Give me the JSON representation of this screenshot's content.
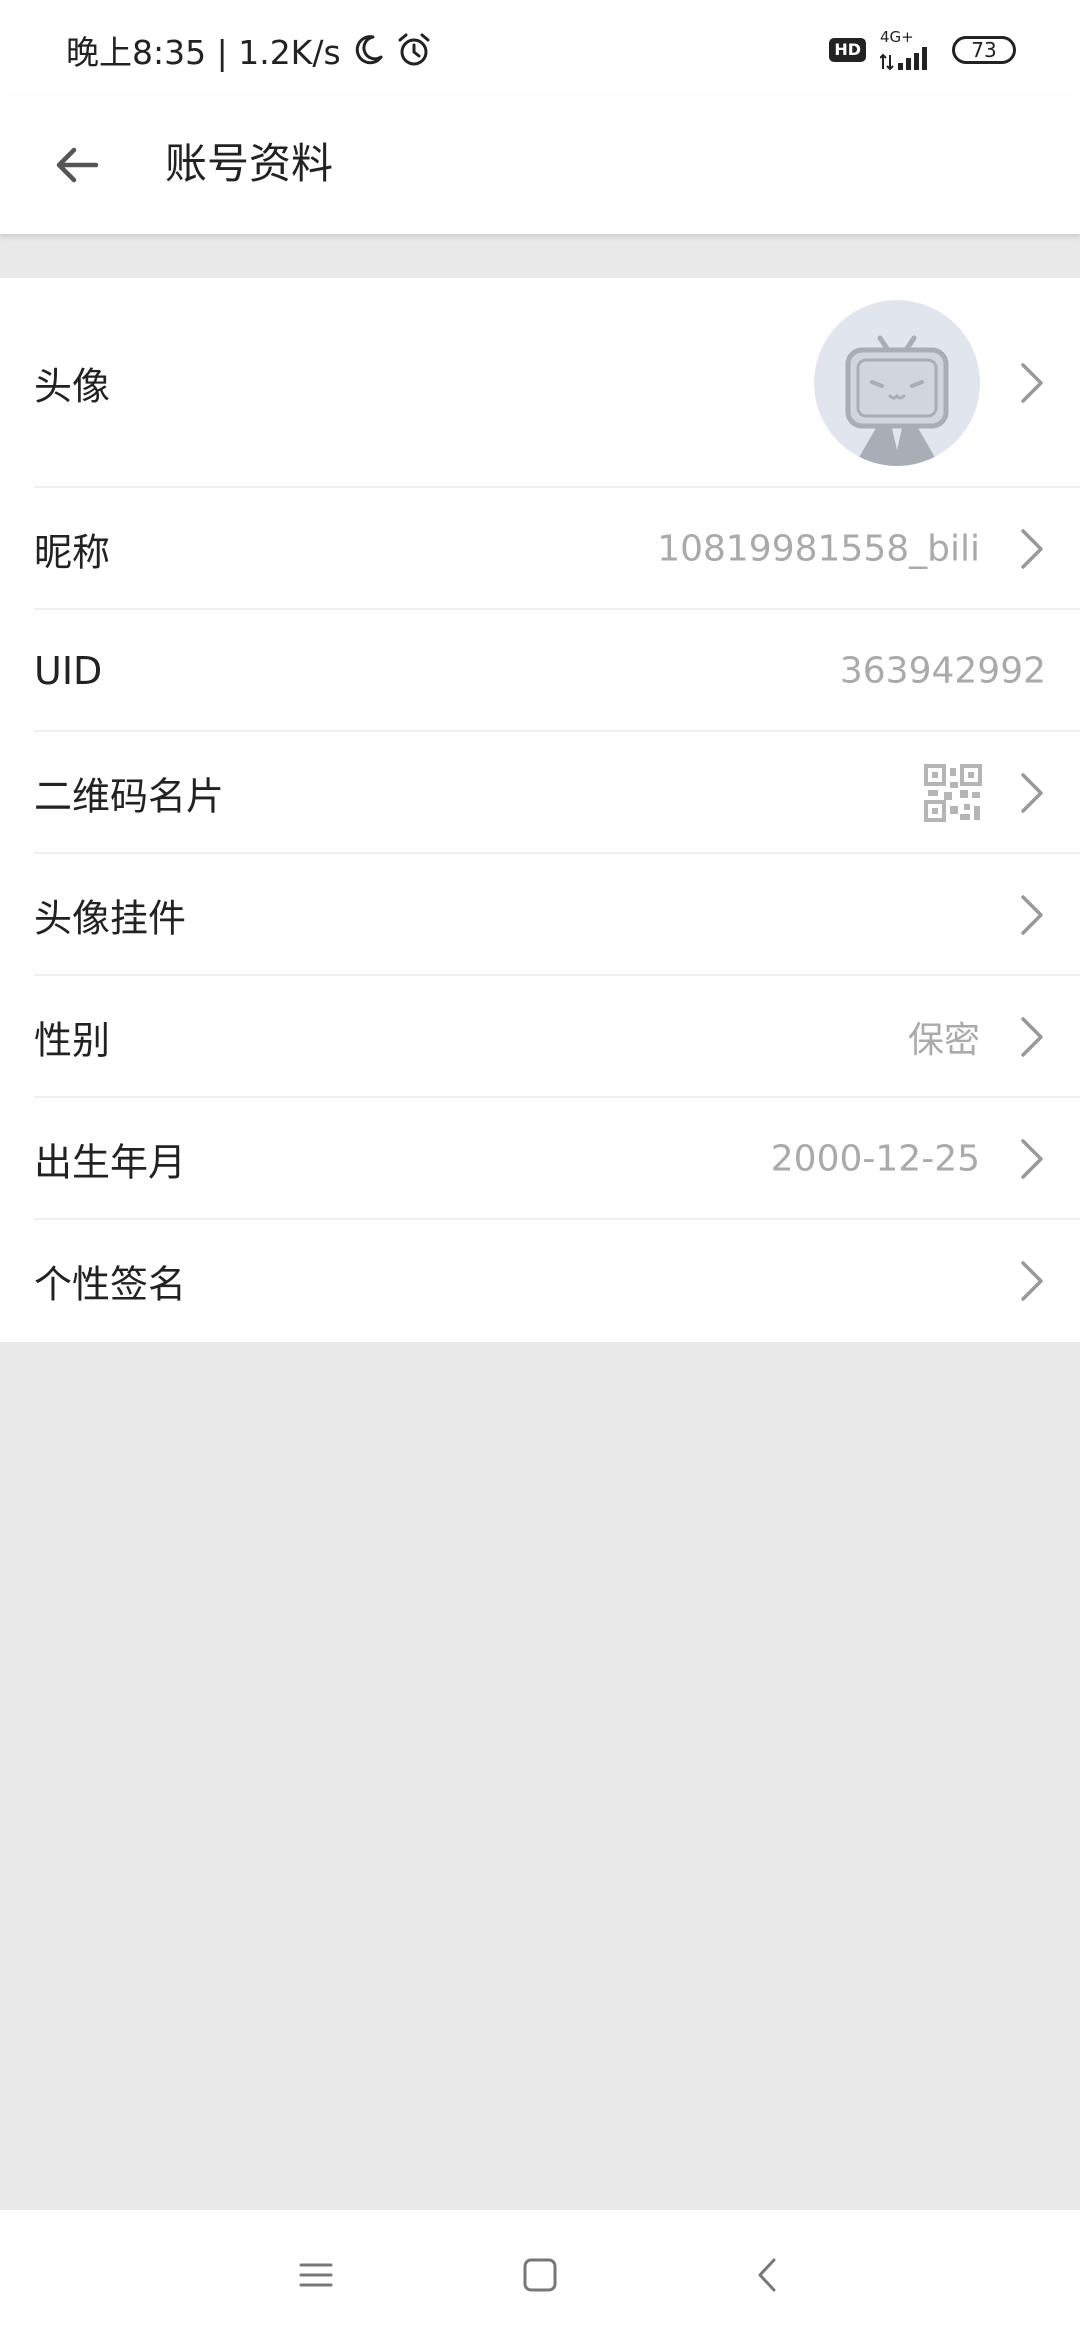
{
  "status_bar": {
    "time_text": "晚上8:35 | 1.2K/s",
    "hd_badge": "HD",
    "network_type": "4G+",
    "battery": "73",
    "icons": [
      "moon-icon",
      "alarm-icon",
      "signal-icon"
    ]
  },
  "header": {
    "title": "账号资料"
  },
  "rows": {
    "avatar": {
      "label": "头像"
    },
    "nickname": {
      "label": "昵称",
      "value": "10819981558_bili"
    },
    "uid": {
      "label": "UID",
      "value": "363942992"
    },
    "qr": {
      "label": "二维码名片"
    },
    "pendant": {
      "label": "头像挂件"
    },
    "gender": {
      "label": "性别",
      "value": "保密"
    },
    "birthday": {
      "label": "出生年月",
      "value": "2000-12-25"
    },
    "signature": {
      "label": "个性签名"
    }
  },
  "colors": {
    "background": "#e9e9e9",
    "surface": "#ffffff",
    "text_primary": "#222222",
    "text_secondary": "#aaaaaa",
    "divider": "#eeeeee",
    "avatar_bg": "#e1e5ee"
  }
}
